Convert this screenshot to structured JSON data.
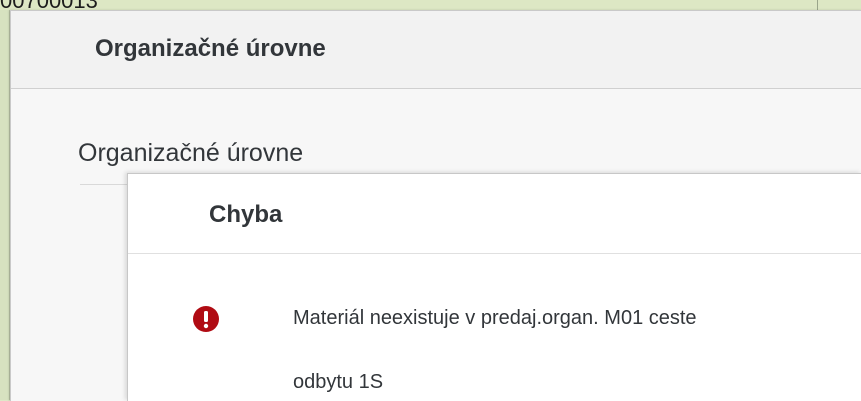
{
  "background": {
    "partial_text": "00700013"
  },
  "outer_dialog": {
    "title": "Organizačné úrovne",
    "section_title": "Organizačné úrovne"
  },
  "error_dialog": {
    "title": "Chyba",
    "message_line1": "Materiál neexistuje v predaj.organ. M01 ceste",
    "message_line2": "odbytu 1S",
    "icon": "error-icon"
  },
  "colors": {
    "error": "#b00b13",
    "text": "#32363a",
    "app_background": "#dfe8c8"
  }
}
